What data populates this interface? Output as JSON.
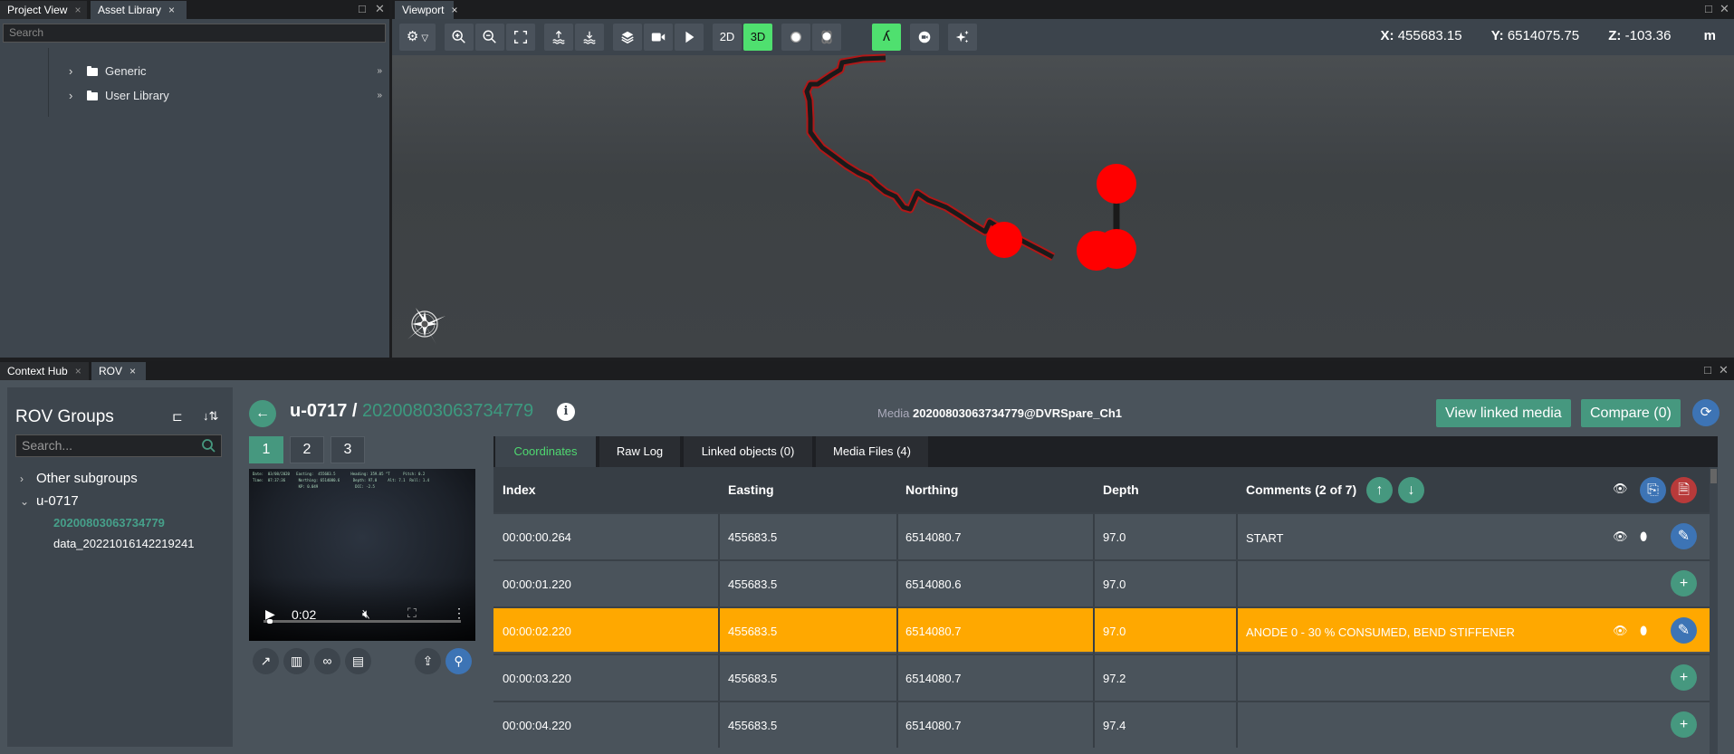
{
  "top_left_tabs": [
    {
      "label": "Project View",
      "active": false
    },
    {
      "label": "Asset Library",
      "active": true
    }
  ],
  "asset_library": {
    "search_placeholder": "Search",
    "items": [
      {
        "label": "Generic",
        "icon": "folder-icon"
      },
      {
        "label": "User Library",
        "icon": "folder-icon"
      }
    ]
  },
  "viewport": {
    "tab_label": "Viewport",
    "toolbar": {
      "settings": "gear-icon",
      "zoom_in": "zoom-in-icon",
      "zoom_out": "zoom-out-icon",
      "fit": "fit-extents-icon",
      "raise": "surface-up-icon",
      "lower": "surface-down-icon",
      "layers": "layers-icon",
      "camera": "video-camera-icon",
      "play": "play-icon",
      "mode_2d": "2D",
      "mode_3d": "3D",
      "active_mode": "3D",
      "lambda_active": true
    },
    "coordinates": {
      "x_label": "X:",
      "x": "455683.15",
      "y_label": "Y:",
      "y": "6514075.75",
      "z_label": "Z:",
      "z": "-103.36",
      "unit": "m"
    }
  },
  "bottom_tabs": [
    {
      "label": "Context Hub",
      "active": false
    },
    {
      "label": "ROV",
      "active": true
    }
  ],
  "rov_groups": {
    "title": "ROV Groups",
    "search_placeholder": "Search...",
    "tree": [
      {
        "label": "Other subgroups",
        "expanded": false,
        "children": []
      },
      {
        "label": "u-0717",
        "expanded": true,
        "children": [
          {
            "label": "20200803063734779",
            "selected": true
          },
          {
            "label": "data_20221016142219241",
            "selected": false
          }
        ]
      }
    ]
  },
  "record": {
    "group": "u-0717",
    "separator": " / ",
    "id": "20200803063734779",
    "media_label": "Media",
    "media_value": "20200803063734779@DVRSpare_Ch1",
    "view_linked_media": "View linked media",
    "compare": "Compare (0)",
    "pages": [
      "1",
      "2",
      "3"
    ],
    "active_page": "1"
  },
  "video": {
    "time": "0:02",
    "progress": 0.02,
    "overlay": "Date:  03/08/2020   Easting:  455683.5       Heading: 359.05 °T      Pitch: 0.2\nTime:  07:37:36      Northing: 6514080.6      Depth: 97.0     Alt: 7.1  Roll: 1.4\n                     KP: 0.049                 DCC: -2.5"
  },
  "data_tabs": [
    {
      "label": "Coordinates",
      "active": true
    },
    {
      "label": "Raw Log",
      "active": false
    },
    {
      "label": "Linked objects (0)",
      "active": false
    },
    {
      "label": "Media Files (4)",
      "active": false
    }
  ],
  "table": {
    "columns": [
      "Index",
      "Easting",
      "Northing",
      "Depth",
      "Comments (2 of 7)"
    ],
    "rows": [
      {
        "index": "00:00:00.264",
        "easting": "455683.5",
        "northing": "6514080.7",
        "depth": "97.0",
        "comment": "START",
        "highlight": false,
        "has_comment": true
      },
      {
        "index": "00:00:01.220",
        "easting": "455683.5",
        "northing": "6514080.6",
        "depth": "97.0",
        "comment": "",
        "highlight": false,
        "has_comment": false
      },
      {
        "index": "00:00:02.220",
        "easting": "455683.5",
        "northing": "6514080.7",
        "depth": "97.0",
        "comment": "ANODE 0 - 30 % CONSUMED, BEND STIFFENER",
        "highlight": true,
        "has_comment": true
      },
      {
        "index": "00:00:03.220",
        "easting": "455683.5",
        "northing": "6514080.7",
        "depth": "97.2",
        "comment": "",
        "highlight": false,
        "has_comment": false
      },
      {
        "index": "00:00:04.220",
        "easting": "455683.5",
        "northing": "6514080.7",
        "depth": "97.4",
        "comment": "",
        "highlight": false,
        "has_comment": false
      }
    ]
  },
  "colors": {
    "accent_green": "#46987f",
    "active_green": "#4fe06f",
    "highlight_row": "#ffa800",
    "blue": "#3d74b5",
    "red": "#b83a3a",
    "track_marker": "#ff0000"
  }
}
